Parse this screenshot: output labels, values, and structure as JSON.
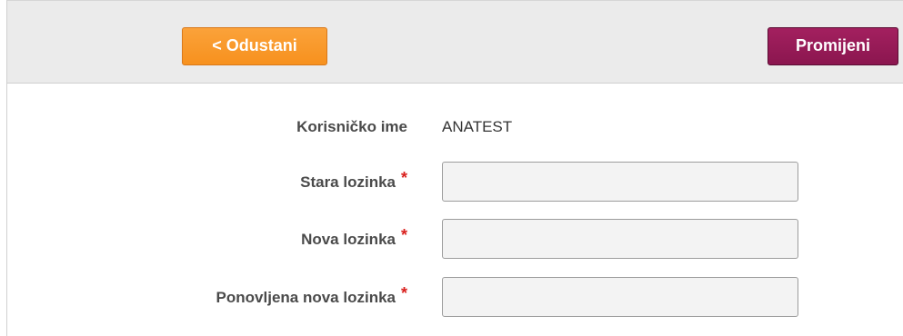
{
  "toolbar": {
    "cancel_label": "< Odustani",
    "change_label": "Promijeni"
  },
  "form": {
    "username": {
      "label": "Korisničko ime",
      "value": "ANATEST"
    },
    "old_password": {
      "label": "Stara lozinka",
      "required_mark": "*",
      "value": ""
    },
    "new_password": {
      "label": "Nova lozinka",
      "required_mark": "*",
      "value": ""
    },
    "repeat_new_password": {
      "label": "Ponovljena nova lozinka",
      "required_mark": "*",
      "value": ""
    }
  },
  "colors": {
    "cancel_button": "#f7911e",
    "change_button": "#8b164f",
    "required_mark": "#d9201d",
    "toolbar_background": "#ebebeb",
    "input_background": "#f3f3f3"
  }
}
